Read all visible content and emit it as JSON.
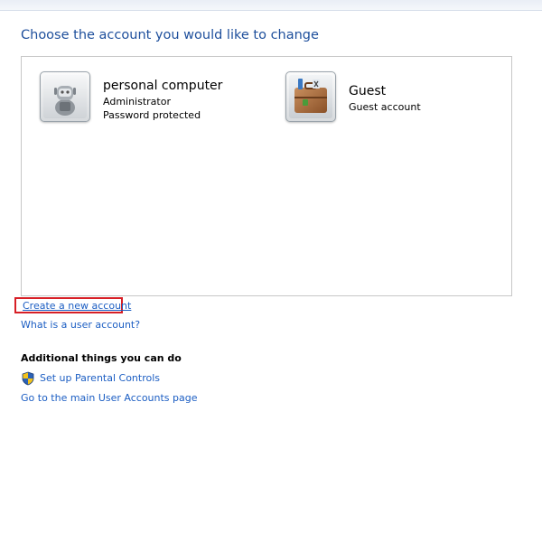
{
  "heading": "Choose the account you would like to change",
  "accounts": [
    {
      "name": "personal computer",
      "lines": [
        "Administrator",
        "Password protected"
      ],
      "icon": "robot-avatar-icon"
    },
    {
      "name": "Guest",
      "lines": [
        "Guest account"
      ],
      "icon": "guest-briefcase-icon"
    }
  ],
  "links": {
    "create_account": "Create a new account",
    "what_is_account": "What is a user account?"
  },
  "additional": {
    "heading": "Additional things you can do",
    "parental_controls": "Set up Parental Controls",
    "parental_icon": "uac-shield-icon",
    "main_page": "Go to the main User Accounts page"
  },
  "colors": {
    "heading_blue": "#1e4f9c",
    "link_blue": "#1c5ec3",
    "highlight_red": "#d71f26"
  }
}
